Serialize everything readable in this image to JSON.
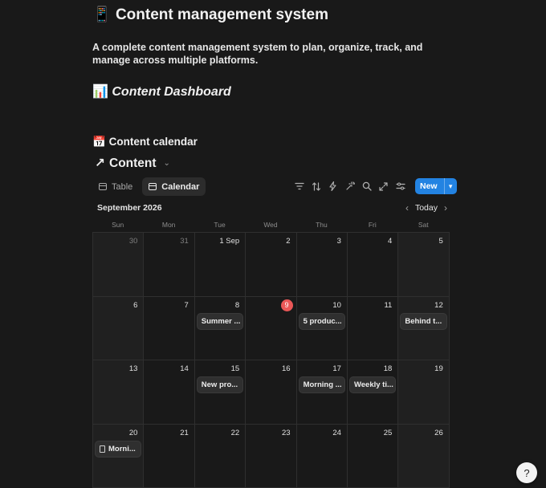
{
  "page": {
    "title_icon": "📱",
    "title": "Content management system",
    "description": "A complete content management system to plan, organize, track, and manage across multiple platforms.",
    "dashboard_icon": "📊",
    "dashboard_heading": "Content Dashboard",
    "calendar_icon": "📅",
    "calendar_heading": "Content calendar"
  },
  "database": {
    "link_icon": "↗",
    "title": "Content",
    "views": [
      {
        "label": "Table",
        "active": false
      },
      {
        "label": "Calendar",
        "active": true
      }
    ],
    "toolbar": {
      "icons": [
        "filter-icon",
        "sort-icon",
        "automation-icon",
        "ai-icon",
        "search-icon",
        "expand-icon",
        "settings-icon"
      ],
      "new_label": "New"
    }
  },
  "calendar": {
    "month": "September 2026",
    "today_label": "Today",
    "weekdays": [
      "Sun",
      "Mon",
      "Tue",
      "Wed",
      "Thu",
      "Fri",
      "Sat"
    ],
    "accent_today": "#eb5757",
    "weeks": [
      [
        {
          "day": "30",
          "muted": true
        },
        {
          "day": "31",
          "muted": true
        },
        {
          "day": "1 Sep"
        },
        {
          "day": "2"
        },
        {
          "day": "3"
        },
        {
          "day": "4"
        },
        {
          "day": "5"
        }
      ],
      [
        {
          "day": "6"
        },
        {
          "day": "7"
        },
        {
          "day": "8",
          "event": "Summer ..."
        },
        {
          "day": "9",
          "today": true
        },
        {
          "day": "10",
          "event": "5 produc..."
        },
        {
          "day": "11"
        },
        {
          "day": "12",
          "event": "Behind t..."
        }
      ],
      [
        {
          "day": "13"
        },
        {
          "day": "14"
        },
        {
          "day": "15",
          "event": "New pro..."
        },
        {
          "day": "16"
        },
        {
          "day": "17",
          "event": "Morning ..."
        },
        {
          "day": "18",
          "event": "Weekly ti..."
        },
        {
          "day": "19"
        }
      ],
      [
        {
          "day": "20",
          "event": "Morni...",
          "event_icon": "doc-icon"
        },
        {
          "day": "21"
        },
        {
          "day": "22"
        },
        {
          "day": "23"
        },
        {
          "day": "24"
        },
        {
          "day": "25"
        },
        {
          "day": "26"
        }
      ]
    ]
  },
  "help_button": {
    "icon": "help-icon",
    "glyph": "?"
  }
}
